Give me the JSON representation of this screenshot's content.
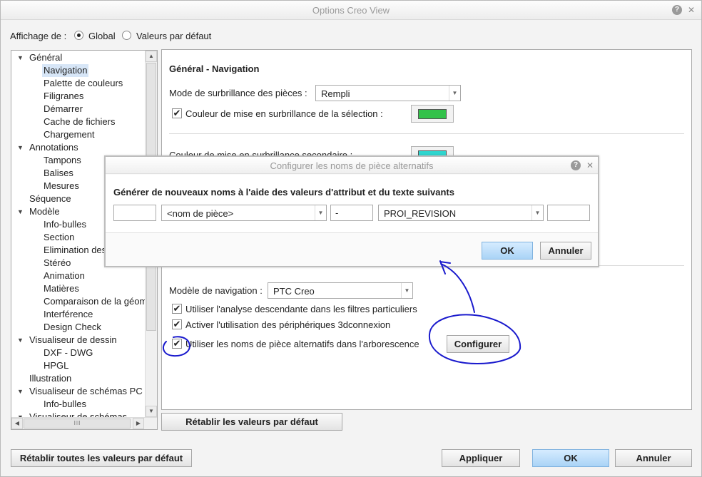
{
  "window": {
    "title": "Options Creo View"
  },
  "display_scope": {
    "label": "Affichage de :",
    "options": [
      {
        "label": "Global",
        "selected": true
      },
      {
        "label": "Valeurs par défaut",
        "selected": false
      }
    ]
  },
  "tree": {
    "items": [
      {
        "label": "Général",
        "level": 0,
        "expander": "▼"
      },
      {
        "label": "Navigation",
        "level": 1,
        "selected": true
      },
      {
        "label": "Palette de couleurs",
        "level": 1
      },
      {
        "label": "Filigranes",
        "level": 1
      },
      {
        "label": "Démarrer",
        "level": 1
      },
      {
        "label": "Cache de fichiers",
        "level": 1
      },
      {
        "label": "Chargement",
        "level": 1
      },
      {
        "label": "Annotations",
        "level": 0,
        "expander": "▼"
      },
      {
        "label": "Tampons",
        "level": 1
      },
      {
        "label": "Balises",
        "level": 1
      },
      {
        "label": "Mesures",
        "level": 1
      },
      {
        "label": "Séquence",
        "level": 0
      },
      {
        "label": "Modèle",
        "level": 0,
        "expander": "▼"
      },
      {
        "label": "Info-bulles",
        "level": 1
      },
      {
        "label": "Section",
        "level": 1
      },
      {
        "label": "Elimination des",
        "level": 1
      },
      {
        "label": "Stéréo",
        "level": 1
      },
      {
        "label": "Animation",
        "level": 1
      },
      {
        "label": "Matières",
        "level": 1
      },
      {
        "label": "Comparaison de la géom",
        "level": 1
      },
      {
        "label": "Interférence",
        "level": 1
      },
      {
        "label": "Design Check",
        "level": 1
      },
      {
        "label": "Visualiseur de dessin",
        "level": 0,
        "expander": "▼"
      },
      {
        "label": "DXF - DWG",
        "level": 1
      },
      {
        "label": "HPGL",
        "level": 1
      },
      {
        "label": "Illustration",
        "level": 0
      },
      {
        "label": "Visualiseur de schémas PC",
        "level": 0,
        "expander": "▼"
      },
      {
        "label": "Info-bulles",
        "level": 1
      },
      {
        "label": "Visualiseur de schémas",
        "level": 0,
        "expander": "▼"
      }
    ],
    "hscroll_grip": "IIII"
  },
  "panel": {
    "title_bold": "Général",
    "title_rest": " - Navigation",
    "highlight_mode_label": "Mode de surbrillance des pièces :",
    "highlight_mode_value": "Rempli",
    "selection_color_label": "Couleur de mise en surbrillance de la sélection :",
    "selection_color": "#33c24a",
    "secondary_color_label": "Couleur de mise en surbrillance secondaire :",
    "secondary_color": "#2fd6cf",
    "nav_model_label": "Modèle de navigation :",
    "nav_model_value": "PTC Creo",
    "opt_top_down": "Utiliser l'analyse descendante dans les filtres particuliers",
    "opt_3dconnexion": "Activer l'utilisation des périphériques 3dconnexion",
    "opt_alt_names": "Utiliser les noms de pièce alternatifs dans l'arborescence",
    "configure_button": "Configurer"
  },
  "restore_defaults_button": "Rétablir les valeurs par défaut",
  "footer": {
    "restore_all": "Rétablir toutes les valeurs par défaut",
    "apply": "Appliquer",
    "ok": "OK",
    "cancel": "Annuler"
  },
  "dialog": {
    "title": "Configurer les noms de pièce alternatifs",
    "instruction": "Générer de nouveaux noms à l'aide des valeurs d'attribut et du texte suivants",
    "field1": "",
    "combo1": "<nom de pièce>",
    "field2": "-",
    "combo2": "PROI_REVISION",
    "field3": "",
    "ok": "OK",
    "cancel": "Annuler"
  },
  "colors": {
    "annotation_ink": "#1a1acd",
    "primary_button": "#a9d3f6"
  }
}
